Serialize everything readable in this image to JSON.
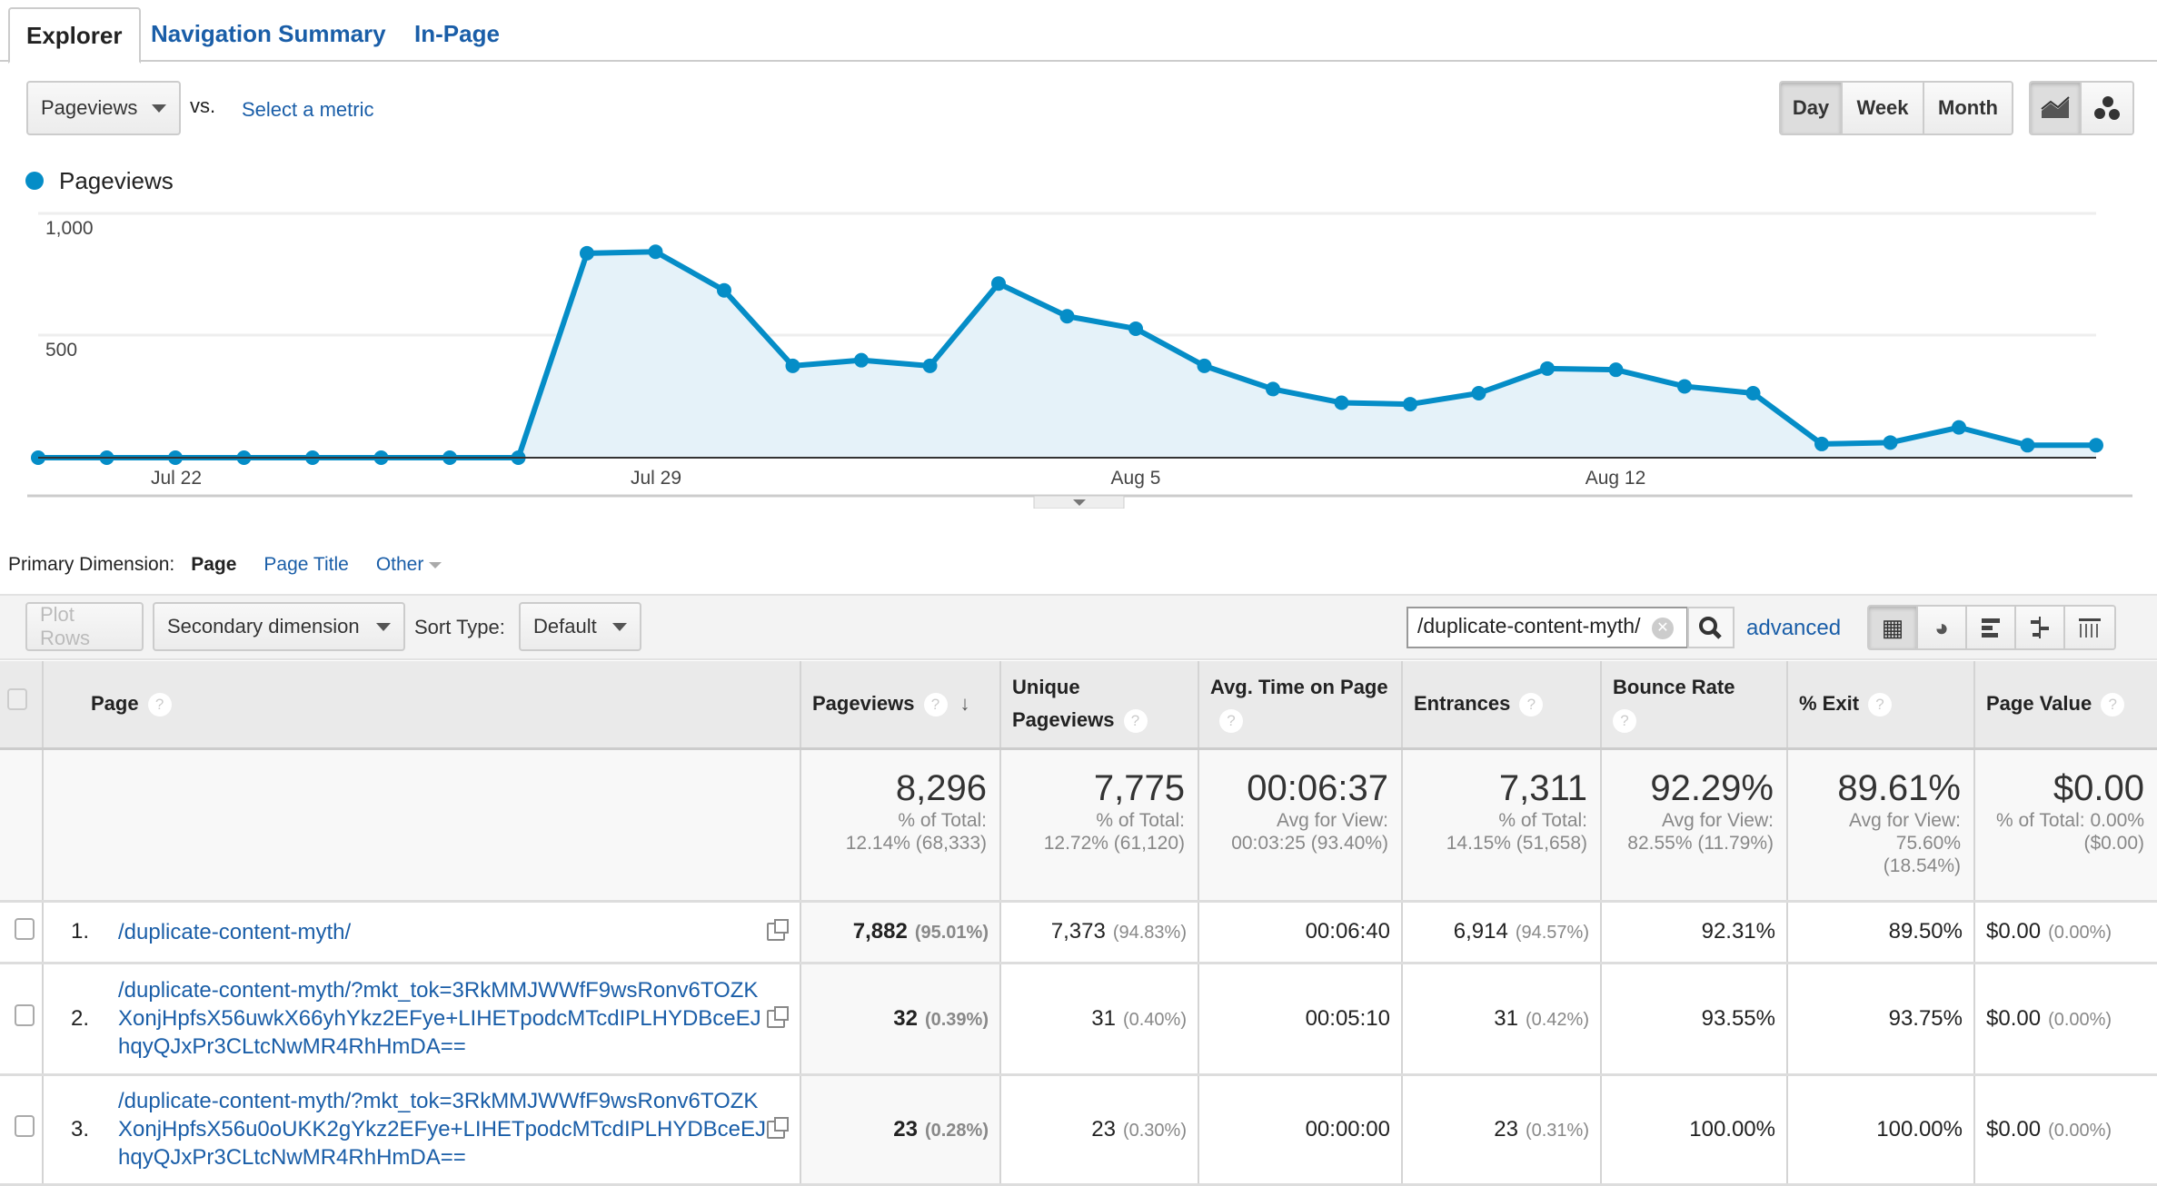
{
  "tabs": [
    "Explorer",
    "Navigation Summary",
    "In-Page"
  ],
  "metric": {
    "selected": "Pageviews",
    "vs": "vs.",
    "select_metric": "Select a metric"
  },
  "period": {
    "options": [
      "Day",
      "Week",
      "Month"
    ],
    "selected": "Day"
  },
  "chart_data": {
    "type": "area",
    "series": [
      {
        "name": "Pageviews",
        "color": "#058dc7",
        "values": [
          0,
          0,
          0,
          0,
          0,
          0,
          0,
          0,
          837,
          843,
          685,
          376,
          399,
          376,
          713,
          579,
          528,
          376,
          281,
          225,
          219,
          264,
          365,
          360,
          292,
          264,
          56,
          62,
          124,
          51,
          51
        ]
      }
    ],
    "x_start": "Jul 20",
    "x_end": "Aug 19",
    "x_ticks": [
      "Jul 22",
      "Jul 29",
      "Aug 5",
      "Aug 12"
    ],
    "y_ticks": [
      "1,000",
      "500"
    ],
    "ylim": [
      0,
      1000
    ],
    "grid": true,
    "legend": "top-left"
  },
  "dimension": {
    "label": "Primary Dimension:",
    "options": [
      "Page",
      "Page Title",
      "Other"
    ],
    "selected": "Page"
  },
  "toolbar": {
    "plot_rows": "Plot Rows",
    "secondary": "Secondary dimension",
    "sort_label": "Sort Type:",
    "sort_value": "Default",
    "search_value": "/duplicate-content-myth/",
    "advanced": "advanced"
  },
  "table": {
    "headers": [
      "Page",
      "Pageviews",
      "Unique Pageviews",
      "Avg. Time on Page",
      "Entrances",
      "Bounce Rate",
      "% Exit",
      "Page Value"
    ],
    "summary": [
      {
        "value": "8,296",
        "l1": "% of Total:",
        "l2": "12.14% (68,333)"
      },
      {
        "value": "7,775",
        "l1": "% of Total:",
        "l2": "12.72% (61,120)"
      },
      {
        "value": "00:06:37",
        "l1": "Avg for View:",
        "l2": "00:03:25 (93.40%)"
      },
      {
        "value": "7,311",
        "l1": "% of Total:",
        "l2": "14.15% (51,658)"
      },
      {
        "value": "92.29%",
        "l1": "Avg for View:",
        "l2": "82.55% (11.79%)"
      },
      {
        "value": "89.61%",
        "l1": "Avg for View:",
        "l2": "75.60%",
        "l3": "(18.54%)"
      },
      {
        "value": "$0.00",
        "l1": "% of Total: 0.00%",
        "l2": "($0.00)"
      }
    ],
    "rows": [
      {
        "num": "1.",
        "page": "/duplicate-content-myth/",
        "pv": "7,882",
        "pv_pct": "(95.01%)",
        "upv": "7,373",
        "upv_pct": "(94.83%)",
        "time": "00:06:40",
        "ent": "6,914",
        "ent_pct": "(94.57%)",
        "bounce": "92.31%",
        "exit": "89.50%",
        "value": "$0.00",
        "value_pct": "(0.00%)"
      },
      {
        "num": "2.",
        "page": "/duplicate-content-myth/?mkt_tok=3RkMMJWWfF9wsRonv6TOZKXonjHpfsX56uwkX66yhYkz2EFye+LIHETpodcMTcdIPLHYDBceEJhqyQJxPr3CLtcNwMR4RhHmDA==",
        "pv": "32",
        "pv_pct": "(0.39%)",
        "upv": "31",
        "upv_pct": "(0.40%)",
        "time": "00:05:10",
        "ent": "31",
        "ent_pct": "(0.42%)",
        "bounce": "93.55%",
        "exit": "93.75%",
        "value": "$0.00",
        "value_pct": "(0.00%)"
      },
      {
        "num": "3.",
        "page": "/duplicate-content-myth/?mkt_tok=3RkMMJWWfF9wsRonv6TOZKXonjHpfsX56u0oUKK2gYkz2EFye+LIHETpodcMTcdIPLHYDBceEJhqyQJxPr3CLtcNwMR4RhHmDA==",
        "pv": "23",
        "pv_pct": "(0.28%)",
        "upv": "23",
        "upv_pct": "(0.30%)",
        "time": "00:00:00",
        "ent": "23",
        "ent_pct": "(0.31%)",
        "bounce": "100.00%",
        "exit": "100.00%",
        "value": "$0.00",
        "value_pct": "(0.00%)"
      }
    ]
  }
}
